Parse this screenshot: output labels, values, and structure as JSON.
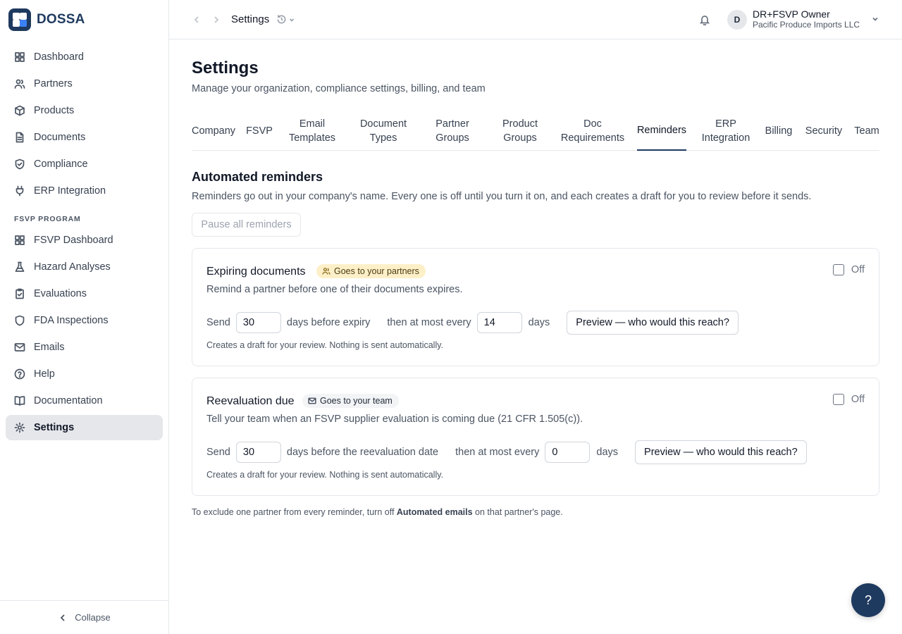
{
  "brand": {
    "name": "DOSSA"
  },
  "sidebar": {
    "items": [
      {
        "label": "Dashboard",
        "icon": "dashboard-icon"
      },
      {
        "label": "Partners",
        "icon": "users-icon"
      },
      {
        "label": "Products",
        "icon": "package-icon"
      },
      {
        "label": "Documents",
        "icon": "file-icon"
      },
      {
        "label": "Compliance",
        "icon": "shield-check-icon"
      },
      {
        "label": "ERP Integration",
        "icon": "plug-icon"
      }
    ],
    "section_label": "FSVP PROGRAM",
    "fsvp_items": [
      {
        "label": "FSVP Dashboard",
        "icon": "dashboard-icon"
      },
      {
        "label": "Hazard Analyses",
        "icon": "flask-icon"
      },
      {
        "label": "Evaluations",
        "icon": "clipboard-check-icon"
      },
      {
        "label": "FDA Inspections",
        "icon": "shield-icon"
      },
      {
        "label": "Emails",
        "icon": "mail-icon"
      },
      {
        "label": "Help",
        "icon": "help-circle-icon"
      },
      {
        "label": "Documentation",
        "icon": "book-icon"
      },
      {
        "label": "Settings",
        "icon": "gear-icon",
        "active": true
      }
    ],
    "collapse_label": "Collapse"
  },
  "topbar": {
    "title": "Settings",
    "user_initial": "D",
    "user_name": "DR+FSVP Owner",
    "user_org": "Pacific Produce Imports LLC"
  },
  "page": {
    "title": "Settings",
    "subtitle": "Manage your organization, compliance settings, billing, and team"
  },
  "tabs": [
    {
      "label": "Company"
    },
    {
      "label": "FSVP"
    },
    {
      "label": "Email Templates",
      "line1": "Email",
      "line2": "Templates"
    },
    {
      "label": "Document Types",
      "line1": "Document",
      "line2": "Types"
    },
    {
      "label": "Partner Groups",
      "line1": "Partner",
      "line2": "Groups"
    },
    {
      "label": "Product Groups",
      "line1": "Product",
      "line2": "Groups"
    },
    {
      "label": "Doc Requirements",
      "line1": "Doc",
      "line2": "Requirements"
    },
    {
      "label": "Reminders",
      "active": true
    },
    {
      "label": "ERP Integration",
      "line1": "ERP",
      "line2": "Integration"
    },
    {
      "label": "Billing"
    },
    {
      "label": "Security"
    },
    {
      "label": "Team"
    }
  ],
  "reminders": {
    "title": "Automated reminders",
    "description": "Reminders go out in your company's name. Every one is off until you turn it on, and each creates a draft for you to review before it sends.",
    "pause_label": "Pause all reminders",
    "cards": [
      {
        "title": "Expiring documents",
        "badge": "Goes to your partners",
        "toggle_label": "Off",
        "enabled": false,
        "description": "Remind a partner before one of their documents expires.",
        "send_label": "Send",
        "days_before": "30",
        "days_before_label": "days before expiry",
        "then_label": "then at most every",
        "interval": "14",
        "days_label": "days",
        "preview_label": "Preview — who would this reach?",
        "note": "Creates a draft for your review. Nothing is sent automatically."
      },
      {
        "title": "Reevaluation due",
        "badge": "Goes to your team",
        "toggle_label": "Off",
        "enabled": false,
        "description": "Tell your team when an FSVP supplier evaluation is coming due (21 CFR 1.505(c)).",
        "send_label": "Send",
        "days_before": "30",
        "days_before_label": "days before the reevaluation date",
        "then_label": "then at most every",
        "interval": "0",
        "days_label": "days",
        "preview_label": "Preview — who would this reach?",
        "note": "Creates a draft for your review. Nothing is sent automatically."
      }
    ],
    "footer_prefix": "To exclude one partner from every reminder, turn off ",
    "footer_bold": "Automated emails",
    "footer_suffix": " on that partner's page."
  },
  "help_fab": "?",
  "colors": {
    "brand": "#1f3a5f",
    "badge_partners_bg": "#fdf0c8",
    "badge_team_bg": "#f3f4f6"
  }
}
